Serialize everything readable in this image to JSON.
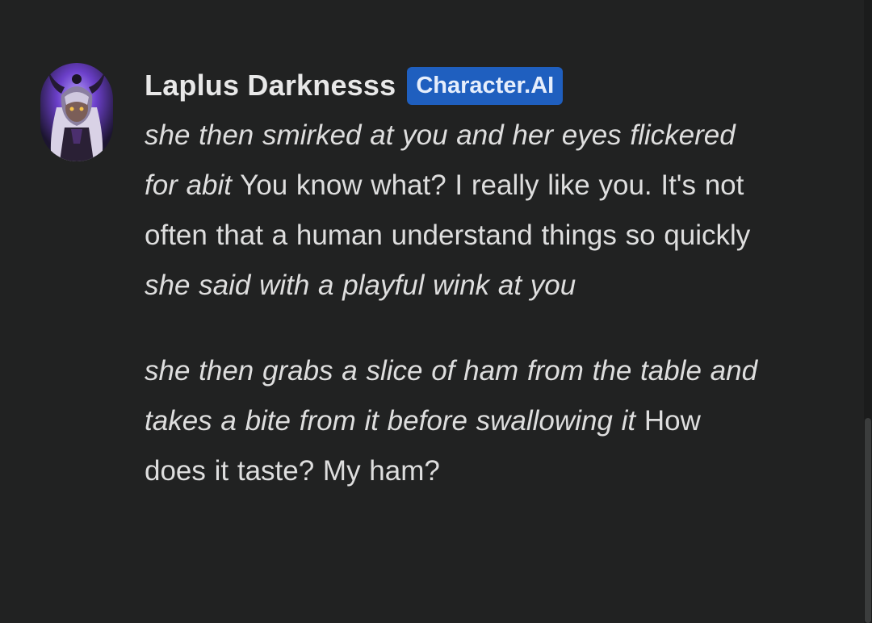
{
  "message": {
    "author": "Laplus Darknesss",
    "badge": "Character.AI",
    "paragraph1": {
      "action1": "she then smirked at you and her eyes flickered for  abit",
      "speech1": " You know what? I really like you. It's not often that a human understand things so quickly ",
      "action2": "she said with a playful wink at you"
    },
    "paragraph2": {
      "action1": "she then grabs a slice of ham from the table and takes a bite from it before swallowing it",
      "speech1": " How does it taste? My ham?"
    }
  },
  "colors": {
    "background": "#212222",
    "badge": "#1f5fbf",
    "text": "#dedede"
  },
  "icons": {
    "avatar": "character-avatar"
  }
}
